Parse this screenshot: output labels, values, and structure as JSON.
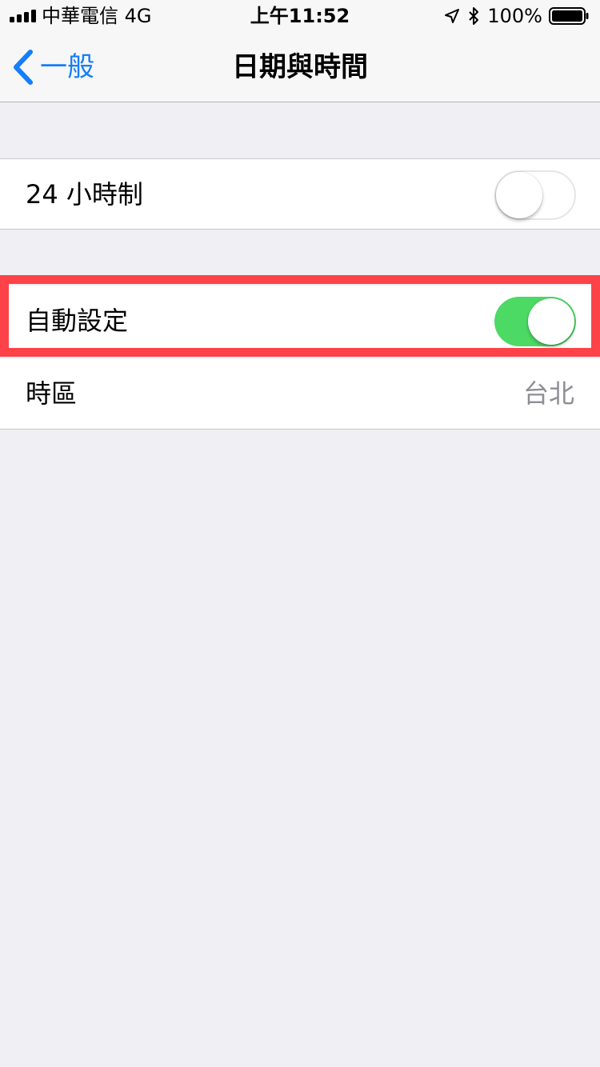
{
  "status_bar": {
    "carrier": "中華電信  4G",
    "time": "上午11:52",
    "battery_percent": "100%",
    "icons": [
      "signal-icon",
      "location-arrow-icon",
      "bluetooth-icon",
      "battery-icon"
    ]
  },
  "nav": {
    "back_label": "一般",
    "title": "日期與時間"
  },
  "settings": {
    "hour24": {
      "label": "24 小時制",
      "on": false
    },
    "auto_set": {
      "label": "自動設定",
      "on": true
    },
    "time_zone": {
      "label": "時區",
      "value": "台北"
    }
  },
  "colors": {
    "accent": "#157efb",
    "toggle_on": "#4cd964",
    "highlight": "#fd4347",
    "background": "#efeff4"
  }
}
